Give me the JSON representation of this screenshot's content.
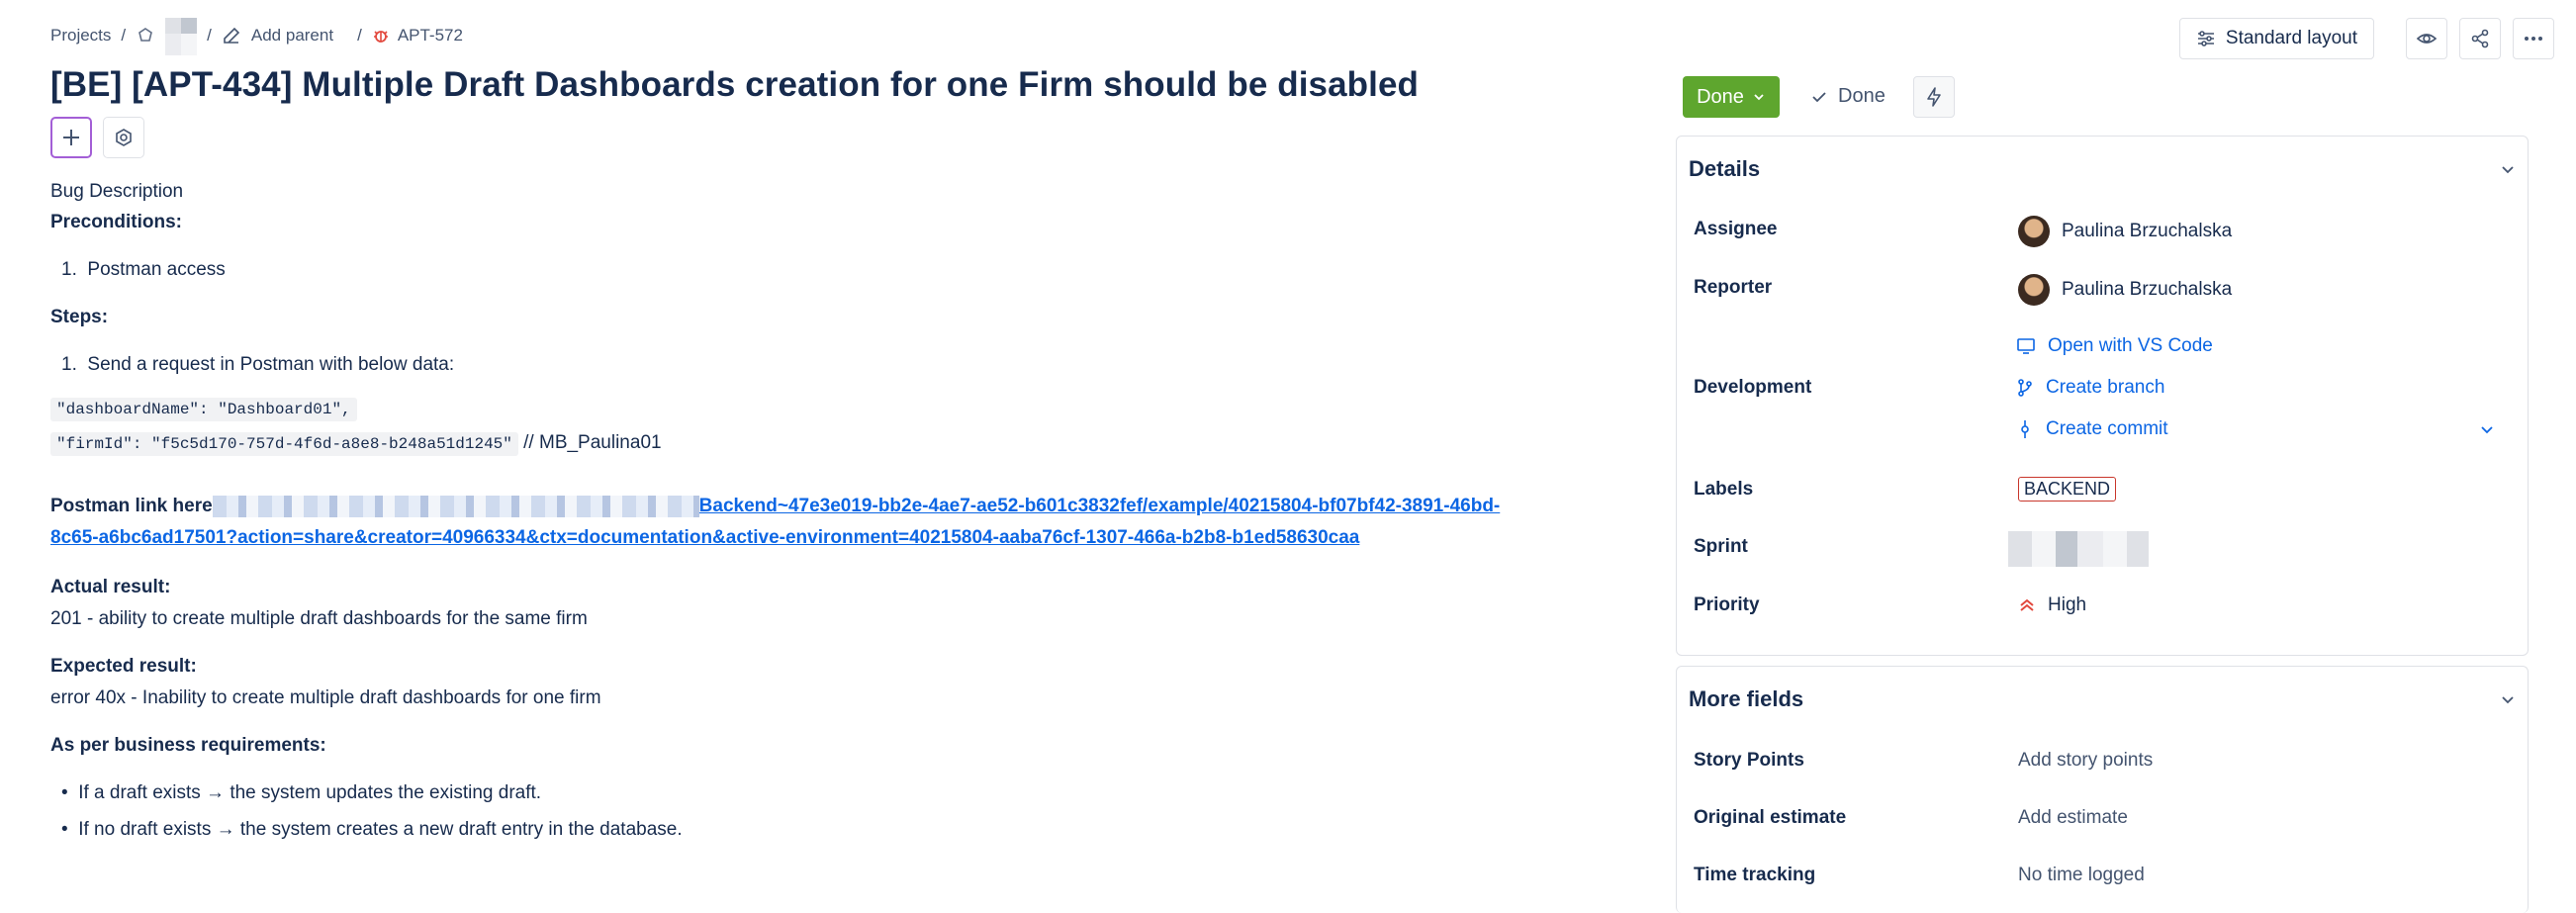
{
  "breadcrumb": {
    "projects": "Projects",
    "add_parent": "Add parent",
    "issue_key": "APT-572"
  },
  "issue": {
    "title": "[BE] [APT-434] Multiple Draft Dashboards creation for one Firm should be disabled"
  },
  "description": {
    "bug_description": "Bug Description",
    "preconditions_heading": "Preconditions:",
    "preconditions": [
      "Postman access"
    ],
    "steps_heading": "Steps:",
    "steps": [
      "Send a request in Postman with below data:"
    ],
    "code_line1": "\"dashboardName\": \"Dashboard01\",",
    "code_line2": "\"firmId\": \"f5c5d170-757d-4f6d-a8e8-b248a51d1245\"",
    "code_comment": " // MB_Paulina01",
    "postman_label": "Postman link here",
    "postman_link_line1": "Backend~47e3e019-bb2e-4ae7-ae52-b601c3832fef/example/40215804-bf07bf42-3891-46bd-",
    "postman_link_line2": "8c65-a6bc6ad17501?action=share&creator=40966334&ctx=documentation&active-environment=40215804-aaba76cf-1307-466a-b2b8-b1ed58630caa",
    "actual_heading": "Actual result:",
    "actual_text": "201 - ability to create multiple draft dashboards for the same firm",
    "expected_heading": "Expected result:",
    "expected_text": "error 40x - Inability to create multiple draft dashboards for one firm",
    "business_heading": "As per business requirements:",
    "business_items": [
      "If a draft exists → the system updates the existing draft.",
      "If no draft exists → the system creates a new draft entry in the database."
    ]
  },
  "toolbar": {
    "layout_label": "Standard layout"
  },
  "status": {
    "button_label": "Done",
    "resolution_label": "Done",
    "color": "#5ea62e"
  },
  "details": {
    "heading": "Details",
    "assignee_label": "Assignee",
    "assignee": "Paulina Brzuchalska",
    "reporter_label": "Reporter",
    "reporter": "Paulina Brzuchalska",
    "development_label": "Development",
    "dev_open_vscode": "Open with VS Code",
    "dev_create_branch": "Create branch",
    "dev_create_commit": "Create commit",
    "labels_label": "Labels",
    "label_value": "BACKEND",
    "sprint_label": "Sprint",
    "priority_label": "Priority",
    "priority_value": "High"
  },
  "more_fields": {
    "heading": "More fields",
    "story_points_label": "Story Points",
    "story_points_value": "Add story points",
    "original_estimate_label": "Original estimate",
    "original_estimate_value": "Add estimate",
    "time_tracking_label": "Time tracking",
    "time_tracking_value": "No time logged"
  }
}
